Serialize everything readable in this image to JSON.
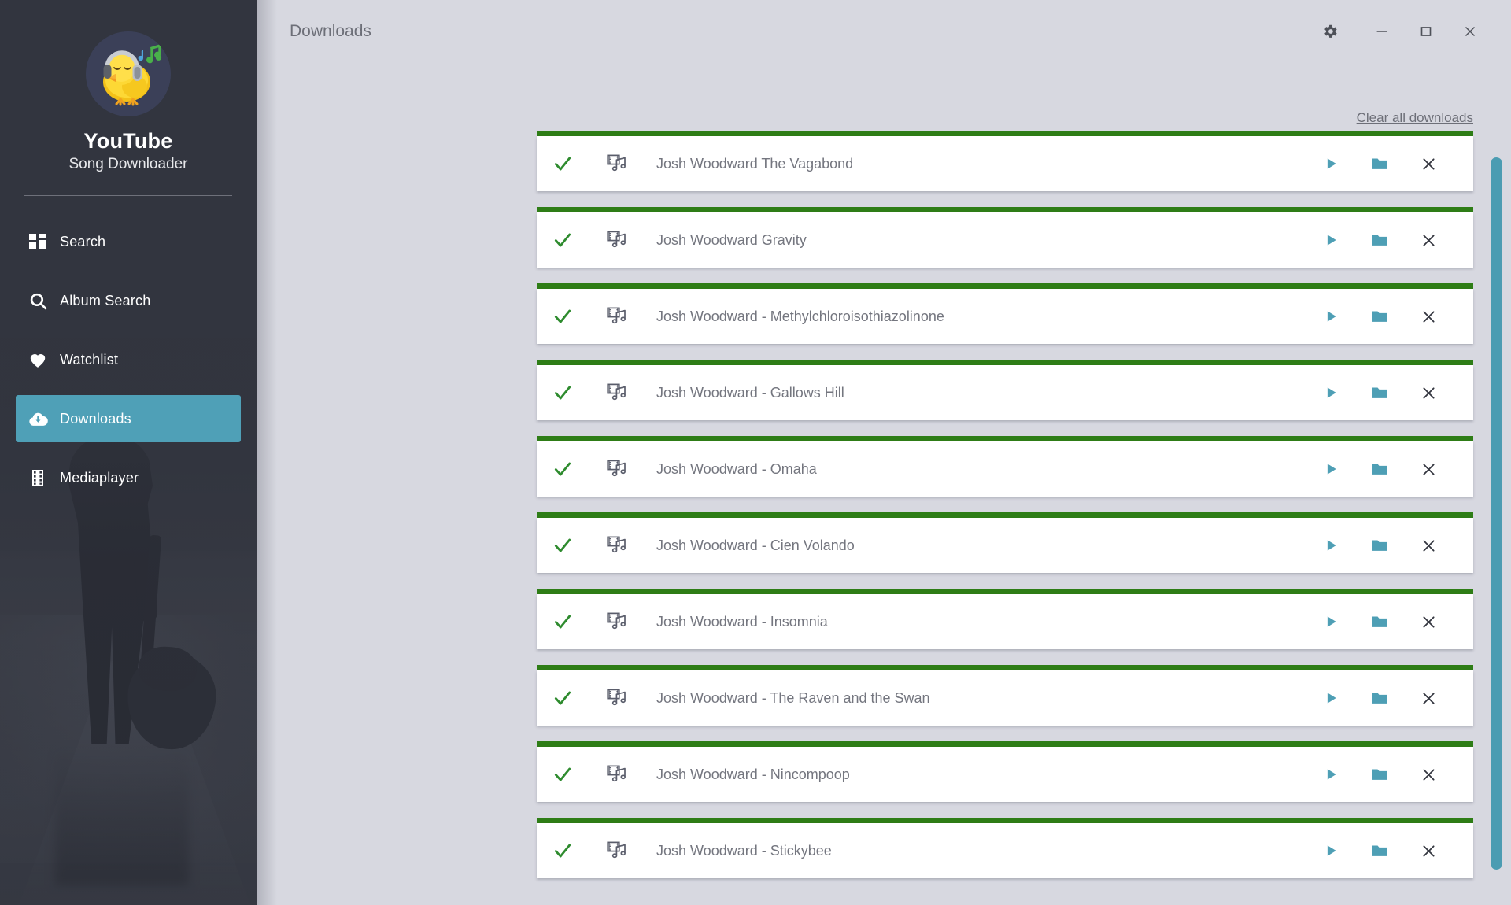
{
  "window": {
    "title": "Downloads",
    "controls": [
      {
        "name": "settings-button",
        "icon": "gear-icon"
      },
      {
        "name": "minimize-button",
        "icon": "minimize-icon"
      },
      {
        "name": "maximize-button",
        "icon": "maximize-icon"
      },
      {
        "name": "close-button",
        "icon": "close-icon"
      }
    ]
  },
  "sidebar": {
    "brand_title": "YouTube",
    "brand_subtitle": "Song Downloader",
    "logo_icon": "chick-with-headphones-logo",
    "items": [
      {
        "label": "Search",
        "icon": "grid-icon",
        "active": false
      },
      {
        "label": "Album Search",
        "icon": "search-icon",
        "active": false
      },
      {
        "label": "Watchlist",
        "icon": "heart-icon",
        "active": false
      },
      {
        "label": "Downloads",
        "icon": "download-cloud-icon",
        "active": true
      },
      {
        "label": "Mediaplayer",
        "icon": "film-icon",
        "active": false
      }
    ]
  },
  "toolbar": {
    "clear_all_label": "Clear all downloads"
  },
  "downloads": {
    "row_icons": {
      "status": "check-icon",
      "filetype": "video-music-file-icon",
      "play": "play-icon",
      "folder": "folder-icon",
      "remove": "close-icon"
    },
    "items": [
      {
        "title": "Josh Woodward The Vagabond",
        "progress": 100,
        "status": "complete"
      },
      {
        "title": "Josh Woodward Gravity",
        "progress": 100,
        "status": "complete"
      },
      {
        "title": "Josh Woodward - Methylchloroisothiazolinone",
        "progress": 100,
        "status": "complete"
      },
      {
        "title": "Josh Woodward - Gallows Hill",
        "progress": 100,
        "status": "complete"
      },
      {
        "title": "Josh Woodward - Omaha",
        "progress": 100,
        "status": "complete"
      },
      {
        "title": "Josh Woodward - Cien Volando",
        "progress": 100,
        "status": "complete"
      },
      {
        "title": "Josh Woodward - Insomnia",
        "progress": 100,
        "status": "complete"
      },
      {
        "title": "Josh Woodward - The Raven and the Swan",
        "progress": 100,
        "status": "complete"
      },
      {
        "title": "Josh Woodward - Nincompoop",
        "progress": 100,
        "status": "complete"
      },
      {
        "title": "Josh Woodward - Stickybee",
        "progress": 100,
        "status": "complete"
      }
    ]
  },
  "colors": {
    "accent_teal": "#4e9fb5",
    "sidebar_bg": "#32353f",
    "content_bg": "#d7d8e0",
    "progress_green": "#2e7d16",
    "check_green": "#2e8b2e",
    "title_text": "#74767f"
  }
}
